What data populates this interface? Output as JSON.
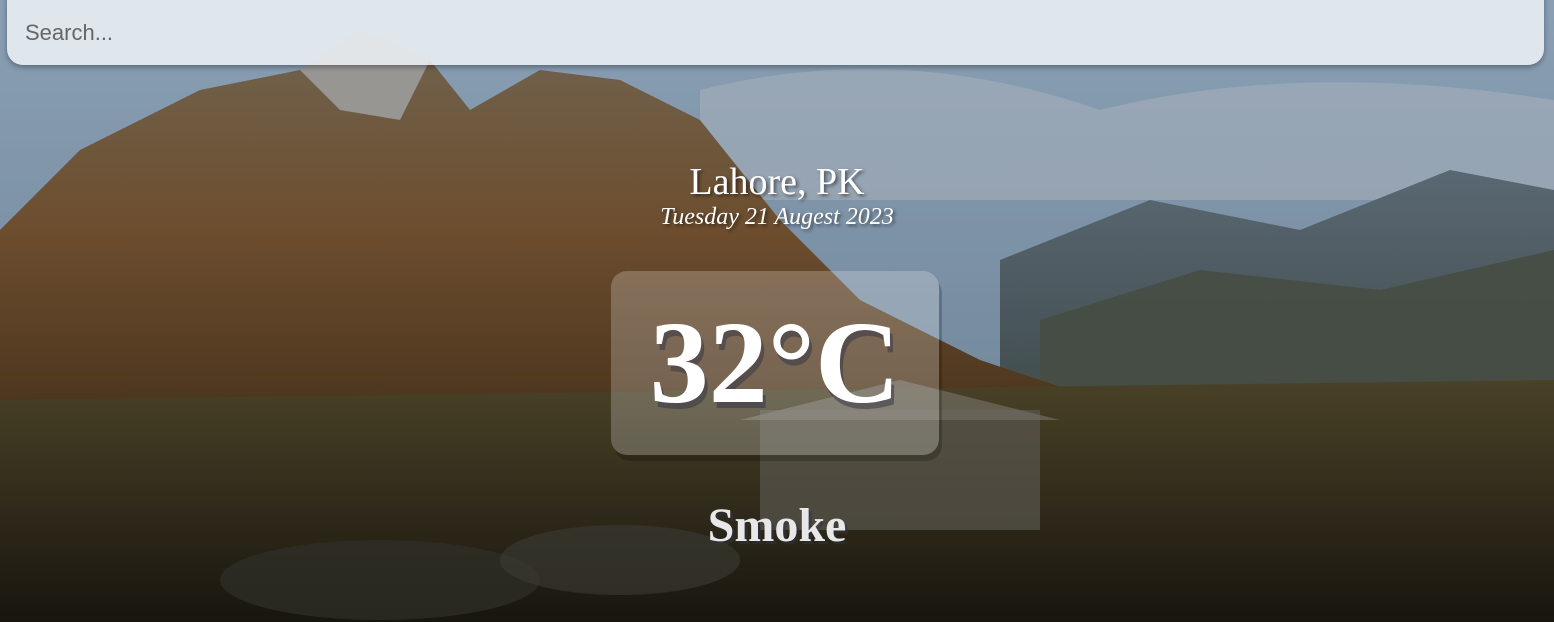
{
  "search": {
    "placeholder": "Search...",
    "value": ""
  },
  "location": {
    "city_country": "Lahore, PK",
    "date": "Tuesday 21 Augest 2023"
  },
  "weather": {
    "temperature": "32°C",
    "condition": "Smoke"
  },
  "colors": {
    "text": "#ffffff",
    "search_bg": "#eef2f6"
  }
}
